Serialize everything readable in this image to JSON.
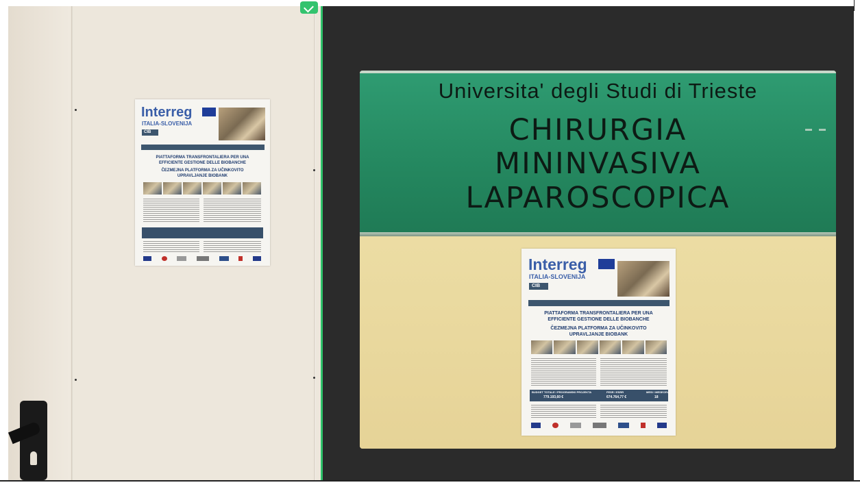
{
  "poster": {
    "brand": "Interreg",
    "program": "ITALIA-SLOVENIJA",
    "project": "CIB",
    "title_it_1": "PIATTAFORMA TRANSFRONTALIERA PER UNA",
    "title_it_2": "EFFICIENTE GESTIONE DELLE BIOBANCHE",
    "title_sl_1": "ČEZMEJNA PLATFORMA ZA UČINKOVITO",
    "title_sl_2": "UPRAVLJANJE BIOBANK",
    "budget_label": "BUDGET TOTALE / PROGRAMSKI PROJEKTA",
    "budget_value": "779.193,60 €",
    "fesr_label": "FESR / ESRR",
    "fesr_value": "674.764,77 €",
    "months_label": "MESI / MESECEV",
    "months_value": "18"
  },
  "sign": {
    "line1": "Universita' degli Studi di Trieste",
    "line2": "CHIRURGIA",
    "line3": "MININVASIVA",
    "line4": "LAPAROSCOPICA"
  },
  "colors": {
    "divider": "#2fc16a",
    "sign_green": "#24875f",
    "wall_yellow": "#ecdda4",
    "dark_bg": "#2b2b2b"
  }
}
